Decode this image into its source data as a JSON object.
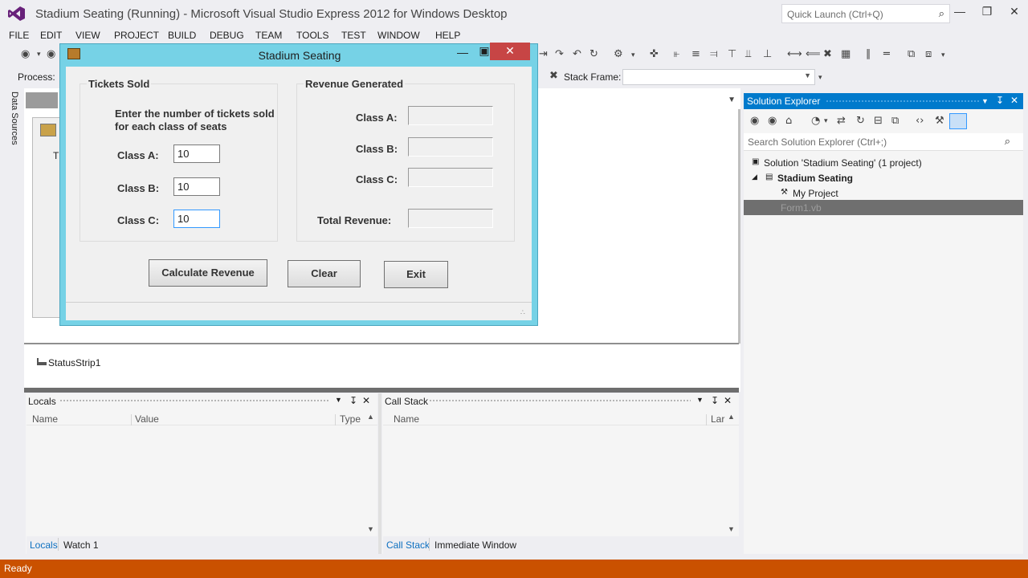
{
  "app": {
    "title": "Stadium Seating (Running) - Microsoft Visual Studio Express 2012 for Windows Desktop",
    "quick_launch_placeholder": "Quick Launch (Ctrl+Q)"
  },
  "menu": [
    "FILE",
    "EDIT",
    "VIEW",
    "PROJECT",
    "BUILD",
    "DEBUG",
    "TEAM",
    "TOOLS",
    "TEST",
    "WINDOW",
    "HELP"
  ],
  "toolbar": {
    "process_label": "Process:",
    "stack_frame_label": "Stack Frame:",
    "stack_frame_value": ""
  },
  "left_strip": {
    "data_sources": "Data Sources"
  },
  "designer": {
    "ghost_label": "T",
    "status_strip_item": "StatusStrip1"
  },
  "form": {
    "title": "Stadium Seating",
    "tickets_group": {
      "title": "Tickets Sold",
      "instructions_line1": "Enter the number of tickets sold",
      "instructions_line2": "for each class of seats",
      "class_a_label": "Class A:",
      "class_a_value": "10",
      "class_b_label": "Class B:",
      "class_b_value": "10",
      "class_c_label": "Class C:",
      "class_c_value": "10"
    },
    "revenue_group": {
      "title": "Revenue Generated",
      "class_a_label": "Class A:",
      "class_a_value": "",
      "class_b_label": "Class B:",
      "class_b_value": "",
      "class_c_label": "Class C:",
      "class_c_value": "",
      "total_label": "Total Revenue:",
      "total_value": ""
    },
    "buttons": {
      "calculate": "Calculate Revenue",
      "clear": "Clear",
      "exit": "Exit"
    }
  },
  "solution_explorer": {
    "title": "Solution Explorer",
    "search_placeholder": "Search Solution Explorer (Ctrl+;)",
    "tree": {
      "solution": "Solution 'Stadium Seating' (1 project)",
      "project": "Stadium Seating",
      "my_project": "My Project",
      "selected_item": "Form1.vb"
    }
  },
  "locals_panel": {
    "title": "Locals",
    "columns": [
      "Name",
      "Value",
      "Type"
    ],
    "tabs": [
      "Locals",
      "Watch 1"
    ]
  },
  "callstack_panel": {
    "title": "Call Stack",
    "columns": [
      "Name",
      "Lar"
    ],
    "tabs": [
      "Call Stack",
      "Immediate Window"
    ]
  },
  "status": {
    "text": "Ready"
  },
  "colors": {
    "accent": "#007acc",
    "status_bar": "#ca5100",
    "form_frame": "#76d2e6",
    "form_close": "#c74545"
  }
}
